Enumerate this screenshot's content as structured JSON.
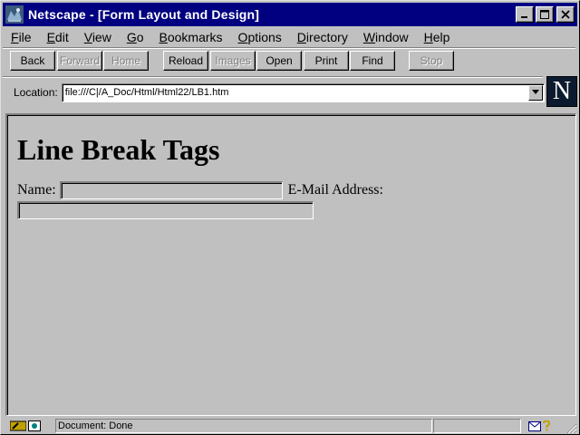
{
  "window": {
    "title": "Netscape - [Form Layout and Design]",
    "controls": [
      "minimize",
      "maximize",
      "close"
    ]
  },
  "menu": {
    "items": [
      {
        "pre": "",
        "ul": "F",
        "rest": "ile"
      },
      {
        "pre": "",
        "ul": "E",
        "rest": "dit"
      },
      {
        "pre": "",
        "ul": "V",
        "rest": "iew"
      },
      {
        "pre": "",
        "ul": "G",
        "rest": "o"
      },
      {
        "pre": "",
        "ul": "B",
        "rest": "ookmarks"
      },
      {
        "pre": "",
        "ul": "O",
        "rest": "ptions"
      },
      {
        "pre": "",
        "ul": "D",
        "rest": "irectory"
      },
      {
        "pre": "",
        "ul": "W",
        "rest": "indow"
      },
      {
        "pre": "",
        "ul": "H",
        "rest": "elp"
      }
    ]
  },
  "toolbar": {
    "back": "Back",
    "forward": "Forward",
    "home": "Home",
    "reload": "Reload",
    "images": "Images",
    "open": "Open",
    "print": "Print",
    "find": "Find",
    "stop": "Stop"
  },
  "location": {
    "label": "Location:",
    "url": "file:///C|/A_Doc/Html/Html22/LB1.htm"
  },
  "logo": {
    "letter": "N"
  },
  "page": {
    "heading": "Line Break Tags",
    "name_label": "Name:",
    "name_value": "",
    "email_label": "E-Mail Address:",
    "email_value": ""
  },
  "status": {
    "text": "Document: Done"
  },
  "colors": {
    "title_bar": "#000080",
    "chrome": "#c0c0c0"
  }
}
